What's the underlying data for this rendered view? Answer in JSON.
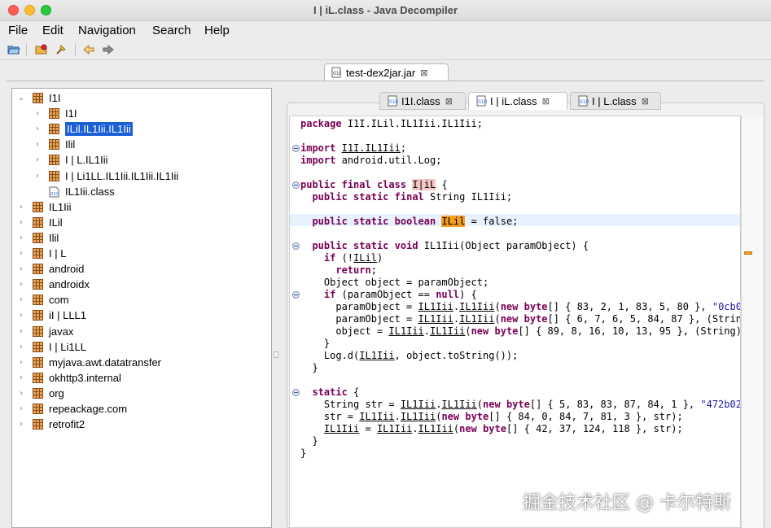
{
  "window": {
    "title": "I | iL.class - Java Decompiler"
  },
  "menu": [
    "File",
    "Edit",
    "Navigation",
    "Search",
    "Help"
  ],
  "toolbar": {
    "buttons": [
      "open-file-icon",
      "open-folder-icon",
      "search-icon",
      "back-arrow-icon",
      "forward-arrow-icon"
    ]
  },
  "file_tab": {
    "label": "test-dex2jar.jar"
  },
  "tree": [
    {
      "label": "I1I",
      "expanded": true,
      "level": 0,
      "type": "package"
    },
    {
      "label": "I1I",
      "level": 1,
      "type": "package"
    },
    {
      "label": "ILil.IL1Iii.IL1Iii",
      "level": 1,
      "type": "package",
      "selected": true
    },
    {
      "label": "Ilil",
      "level": 1,
      "type": "package"
    },
    {
      "label": "I | L.IL1Iii",
      "level": 1,
      "type": "package"
    },
    {
      "label": "I | Li1LL.IL1Iii.IL1Iii.IL1Iii",
      "level": 1,
      "type": "package"
    },
    {
      "label": "IL1Iii.class",
      "level": 1,
      "type": "class"
    },
    {
      "label": "IL1Iii",
      "level": 0,
      "type": "package"
    },
    {
      "label": "ILil",
      "level": 0,
      "type": "package"
    },
    {
      "label": "Ilil",
      "level": 0,
      "type": "package"
    },
    {
      "label": "I | L",
      "level": 0,
      "type": "package"
    },
    {
      "label": "android",
      "level": 0,
      "type": "package"
    },
    {
      "label": "androidx",
      "level": 0,
      "type": "package"
    },
    {
      "label": "com",
      "level": 0,
      "type": "package"
    },
    {
      "label": "iI | LLL1",
      "level": 0,
      "type": "package"
    },
    {
      "label": "javax",
      "level": 0,
      "type": "package"
    },
    {
      "label": "I | Li1LL",
      "level": 0,
      "type": "package"
    },
    {
      "label": "myjava.awt.datatransfer",
      "level": 0,
      "type": "package"
    },
    {
      "label": "okhttp3.internal",
      "level": 0,
      "type": "package"
    },
    {
      "label": "org",
      "level": 0,
      "type": "package"
    },
    {
      "label": "repeackage.com",
      "level": 0,
      "type": "package"
    },
    {
      "label": "retrofit2",
      "level": 0,
      "type": "package"
    }
  ],
  "class_tabs": [
    {
      "label": "I1I.class",
      "active": false
    },
    {
      "label": "I | iL.class",
      "active": true
    },
    {
      "label": "I | L.class",
      "active": false
    }
  ],
  "code": {
    "l_pkg": "I1I.ILil.IL1Iii.IL1Iii;",
    "l_imp1": "I1I.IL1Iii",
    "l_imp2": "android.util.Log;",
    "l_cls_name": "I|iL",
    "l_f1": "String IL1Iii;",
    "l_f2_name": "ILil",
    "l_f2_val": "= false;",
    "l_m_sig": "IL1Iii(Object paramObject) {",
    "l_if1_arg": "ILil",
    "l_obj": "Object object = paramObject;",
    "l_if2": "(paramObject == ",
    "l_p1_a": "paramObject = ",
    "l_p1_args": "{ 83, 2, 1, 83, 5, 80 }, ",
    "l_p1_str": "\"0cb0",
    "l_p2_args": "{ 6, 7, 6, 5, 84, 87 }, (Strin",
    "l_p3_a": "object = ",
    "l_p3_args": "{ 89, 8, 16, 10, 13, 95 }, (String)",
    "l_log_a": "Log.d(",
    "l_log_b": ", object.toString());",
    "l_s1_a": "String str = ",
    "l_s1_args": "{ 5, 83, 83, 87, 84, 1 }, ",
    "l_s1_str": "\"472b02",
    "l_s2_a": "str = ",
    "l_s2_args": "{ 84, 0, 84, 7, 81, 3 }, str);",
    "l_s3_args": "{ 42, 37, 124, 118 }, str);",
    "id_a": "IL1Iii",
    "id_b": "IL1Iii",
    "id_c": "IL1Iii",
    "kw_package": "package",
    "kw_import": "import",
    "kw_public": "public",
    "kw_final": "final",
    "kw_class": "class",
    "kw_static": "static",
    "kw_boolean": "boolean",
    "kw_void": "void",
    "kw_if": "if",
    "kw_return": "return",
    "kw_null": "null",
    "kw_new": "new",
    "kw_byte": "byte"
  },
  "watermark": "掘金技术社区 @ 卡尔特斯",
  "colors": {
    "selection": "#1a5fd6",
    "keyword": "#7a0055",
    "string": "#1a1aa8",
    "highlight": "#f59d20"
  }
}
